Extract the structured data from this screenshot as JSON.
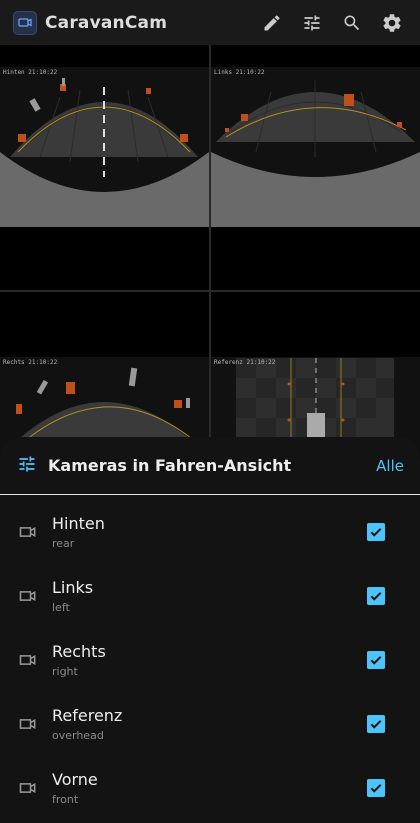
{
  "app": {
    "title": "CaravanCam"
  },
  "topbar": {
    "actions": [
      "pencil-icon",
      "tune-icon",
      "search-icon",
      "gear-icon"
    ]
  },
  "grid": {
    "cells": [
      {
        "label": "Hinten   21:10:22"
      },
      {
        "label": "Links   21:10:22"
      },
      {
        "label": "Rechts   21:10:22"
      },
      {
        "label": "Referenz   21:10:22"
      }
    ]
  },
  "sheet": {
    "title": "Kameras in Fahren-Ansicht",
    "all_label": "Alle",
    "cameras": [
      {
        "name": "Hinten",
        "sub": "rear",
        "checked": true
      },
      {
        "name": "Links",
        "sub": "left",
        "checked": true
      },
      {
        "name": "Rechts",
        "sub": "right",
        "checked": true
      },
      {
        "name": "Referenz",
        "sub": "overhead",
        "checked": true
      },
      {
        "name": "Vorne",
        "sub": "front",
        "checked": true
      }
    ]
  },
  "colors": {
    "accent": "#4fc3f7",
    "sheet_bg": "#131313",
    "topbar_bg": "#1a1a1a"
  }
}
